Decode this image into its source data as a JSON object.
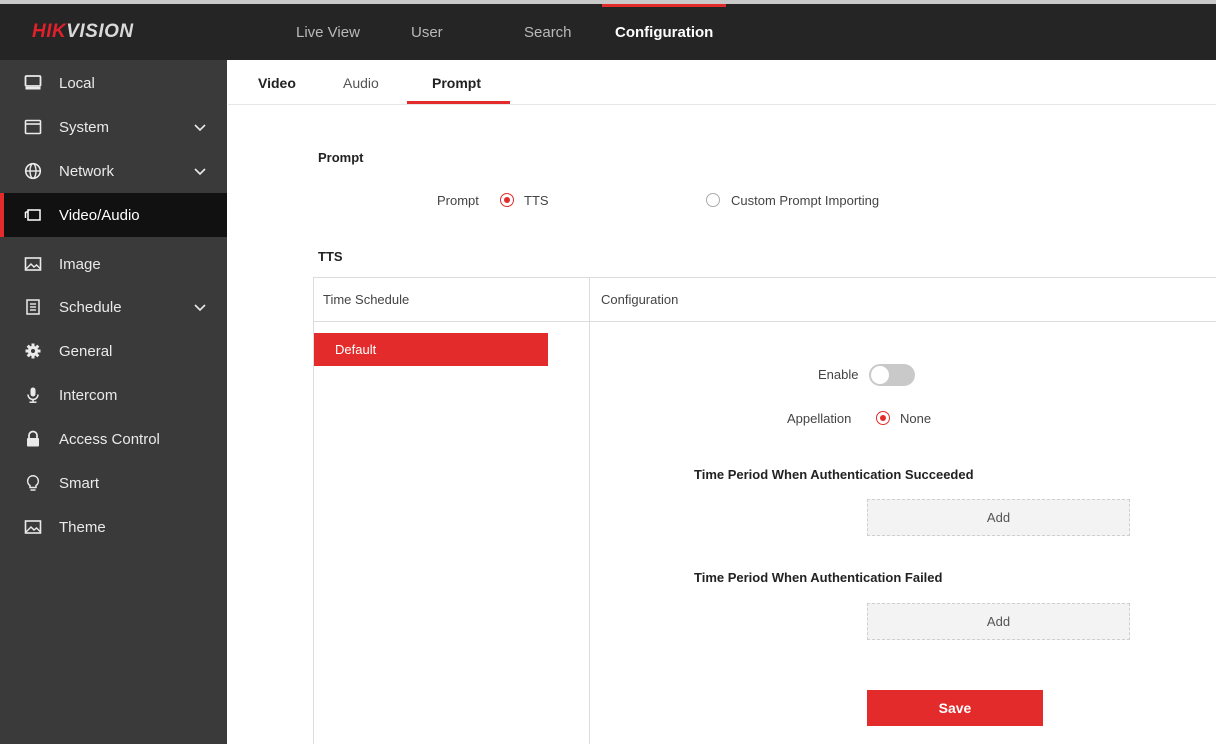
{
  "header": {
    "logo_a": "HIK",
    "logo_b": "VISION",
    "nav": [
      "Live View",
      "User",
      "Search",
      "Configuration"
    ],
    "active_nav": "Configuration"
  },
  "sidebar": {
    "items": [
      {
        "label": "Local",
        "icon": "monitor-icon",
        "expandable": false
      },
      {
        "label": "System",
        "icon": "window-icon",
        "expandable": true
      },
      {
        "label": "Network",
        "icon": "globe-icon",
        "expandable": true
      },
      {
        "label": "Video/Audio",
        "icon": "camera-icon",
        "expandable": false,
        "active": true
      },
      {
        "label": "Image",
        "icon": "image-icon",
        "expandable": false
      },
      {
        "label": "Schedule",
        "icon": "calendar-icon",
        "expandable": true
      },
      {
        "label": "General",
        "icon": "gear-icon",
        "expandable": false
      },
      {
        "label": "Intercom",
        "icon": "microphone-icon",
        "expandable": false
      },
      {
        "label": "Access Control",
        "icon": "lock-icon",
        "expandable": false
      },
      {
        "label": "Smart",
        "icon": "bulb-icon",
        "expandable": false
      },
      {
        "label": "Theme",
        "icon": "image-icon",
        "expandable": false
      }
    ]
  },
  "tabs": {
    "video": "Video",
    "audio": "Audio",
    "prompt": "Prompt",
    "active": "Prompt"
  },
  "prompt_section": {
    "title": "Prompt",
    "label": "Prompt",
    "option_tts": "TTS",
    "option_custom": "Custom Prompt Importing",
    "selected": "TTS"
  },
  "tts": {
    "title": "TTS",
    "col_schedule": "Time Schedule",
    "col_config": "Configuration",
    "schedule_item": "Default",
    "enable_label": "Enable",
    "enable_on": false,
    "appellation_label": "Appellation",
    "appellation_value": "None",
    "success_title": "Time Period When Authentication Succeeded",
    "failed_title": "Time Period When Authentication Failed",
    "add_label": "Add",
    "save_label": "Save"
  },
  "colors": {
    "accent": "#e32b2b",
    "topbar": "#252525",
    "sidebar": "#3a3a3a",
    "sidebar_active": "#111111"
  }
}
